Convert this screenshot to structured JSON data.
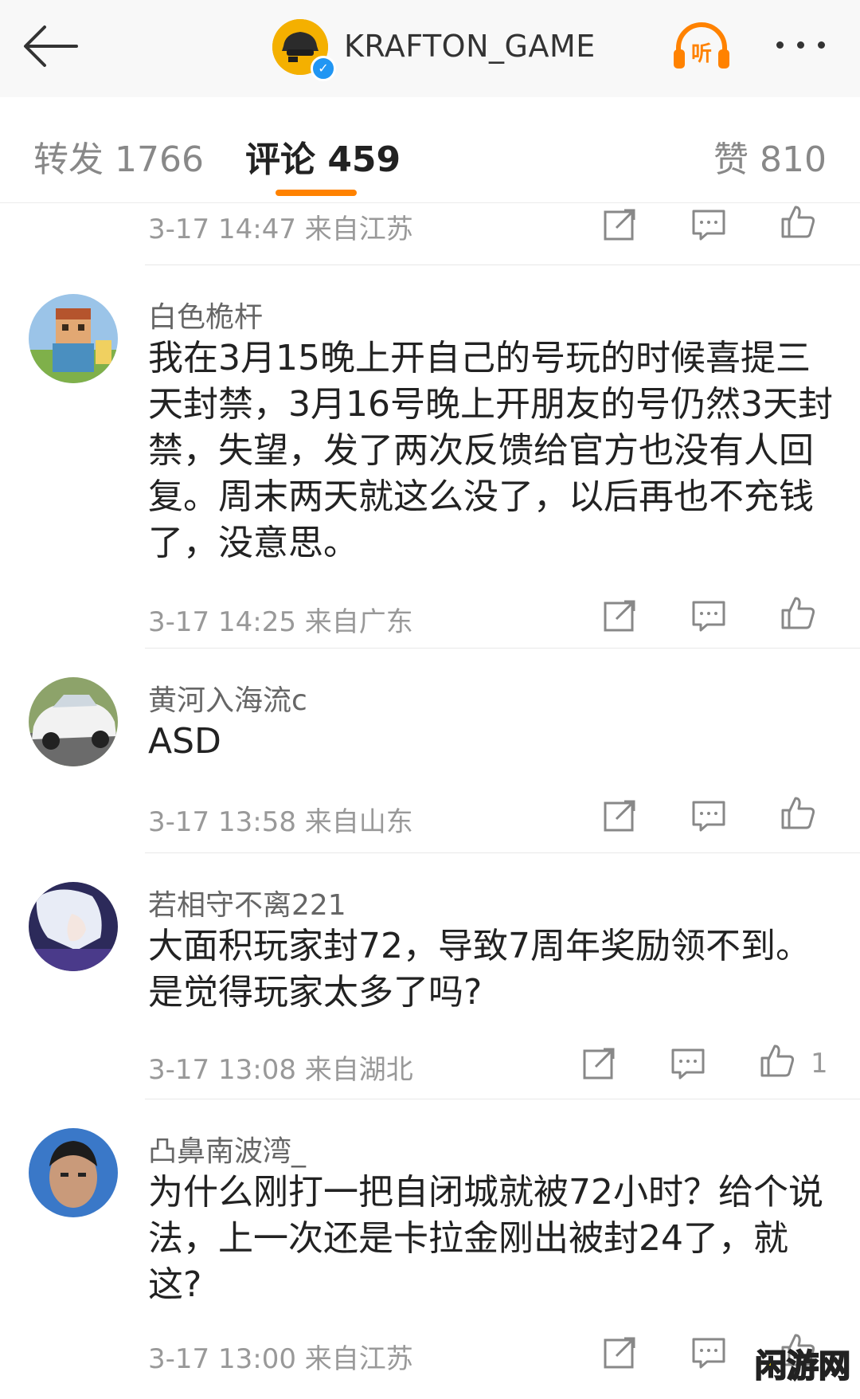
{
  "header": {
    "account_name": "KRAFTON_GAME",
    "listen_label": "听",
    "accent_color": "#ff8200"
  },
  "tabs": {
    "repost": "转发 1766",
    "comments": "评论 459",
    "likes": "赞 810"
  },
  "previous_comment": {
    "meta": "3-17 14:47  来自江苏"
  },
  "comments": [
    {
      "username": "白色桅杆",
      "text": "我在3月15晚上开自己的号玩的时候喜提三天封禁，3月16号晚上开朋友的号仍然3天封禁，失望，发了两次反馈给官方也没有人回复。周末两天就这么没了，以后再也不充钱了，没意思。",
      "meta": "3-17 14:25  来自广东",
      "likes": ""
    },
    {
      "username": "黄河入海流c",
      "text": "ASD",
      "meta": "3-17 13:58  来自山东",
      "likes": ""
    },
    {
      "username": "若相守不离221",
      "text": "大面积玩家封72，导致7周年奖励领不到。是觉得玩家太多了吗?",
      "meta": "3-17 13:08  来自湖北",
      "likes": "1"
    },
    {
      "username": "凸鼻南波湾_",
      "text": "为什么刚打一把自闭城就被72小时？给个说法，上一次还是卡拉金刚出被封24了，就这?",
      "meta": "3-17 13:00  来自江苏",
      "likes": ""
    }
  ],
  "watermark": "闲游网"
}
